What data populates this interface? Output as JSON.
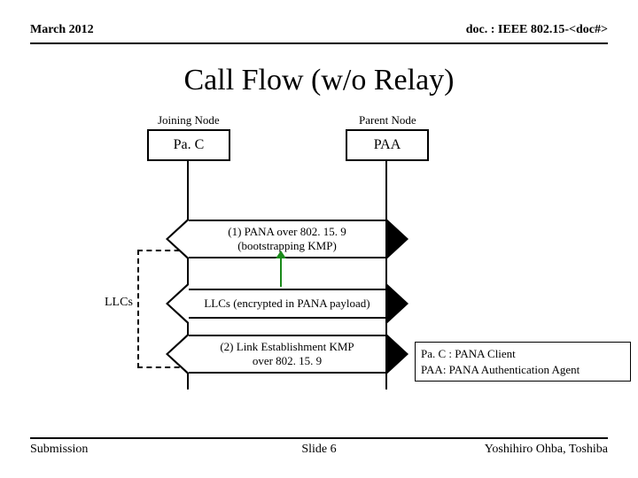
{
  "header": {
    "date": "March 2012",
    "doc": "doc. : IEEE 802.15-<doc#>"
  },
  "title": "Call Flow (w/o Relay)",
  "nodes": {
    "joining": "Joining Node",
    "parent": "Parent Node",
    "pac": "Pa. C",
    "paa": "PAA"
  },
  "arrows": {
    "a1": "(1)  PANA over 802. 15. 9\n(bootstrapping KMP)",
    "a2": "LLCs (encrypted in PANA payload)",
    "a3": "(2) Link Establishment KMP\nover 802. 15. 9"
  },
  "llcs": "LLCs",
  "legend": {
    "l1": "Pa. C : PANA Client",
    "l2": "PAA: PANA Authentication Agent"
  },
  "footer": {
    "left": "Submission",
    "center": "Slide 6",
    "right": "Yoshihiro Ohba, Toshiba"
  }
}
